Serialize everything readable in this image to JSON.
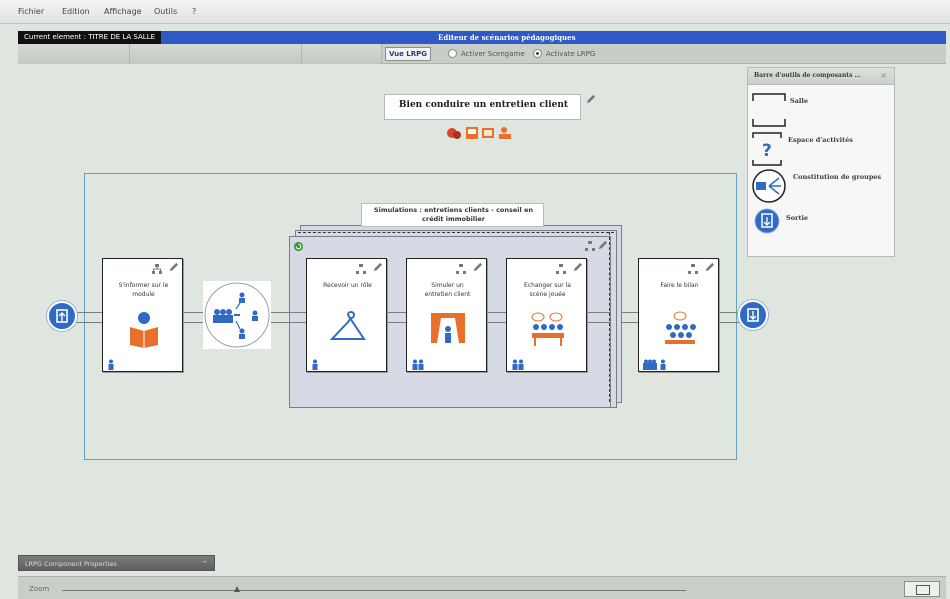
{
  "menu": [
    "Fichier",
    "Edition",
    "Affichage",
    "Outils",
    "?"
  ],
  "titlebar": {
    "current_element": "Current element : TITRE DE LA SALLE",
    "editor_title": "Editeur de scénarios pédagogiques"
  },
  "toolbar": {
    "view_button": "Vue LRPG",
    "radio_scengame": "Activer Scengame",
    "radio_lrpg": "Activate LRPG",
    "selected": "radio_lrpg"
  },
  "scenario": {
    "title": "Bien conduire un entretien client"
  },
  "simulation_group": {
    "label_line1": "Simulations : entretiens clients - conseil en",
    "label_line2": "crédit immobilier"
  },
  "activities": [
    {
      "title_line1": "S'informer sur le",
      "title_line2": "module",
      "icon": "reading-person-icon",
      "group": "single"
    },
    {
      "title_line1": "Recevoir un rôle",
      "title_line2": "",
      "icon": "hanger-icon",
      "group": "single"
    },
    {
      "title_line1": "Simuler un",
      "title_line2": "entretien client",
      "icon": "stage-curtain-icon",
      "group": "pair"
    },
    {
      "title_line1": "Echanger sur la",
      "title_line2": "scène jouée",
      "icon": "discussion-group-icon",
      "group": "pair"
    },
    {
      "title_line1": "Faire le bilan",
      "title_line2": "",
      "icon": "audience-icon",
      "group": "multi-plus-single"
    }
  ],
  "palette": {
    "title": "Barre d'outils de composants ...",
    "close": "×",
    "items": [
      {
        "label": "Salle",
        "icon": "room-bracket-icon"
      },
      {
        "label": "Espace d'activités",
        "icon": "activity-space-icon"
      },
      {
        "label": "Constitution de groupes",
        "icon": "group-formation-icon"
      },
      {
        "label": "Sortie",
        "icon": "exit-icon"
      }
    ]
  },
  "properties_panel": {
    "label": "LRPG Component Properties",
    "minimize": "–"
  },
  "zoom": {
    "label": "Zoom"
  },
  "colors": {
    "accent_blue": "#2f59c5",
    "exit_blue": "#2f6bc4",
    "icon_orange": "#e8702a",
    "room_border": "#5fa4c8"
  }
}
